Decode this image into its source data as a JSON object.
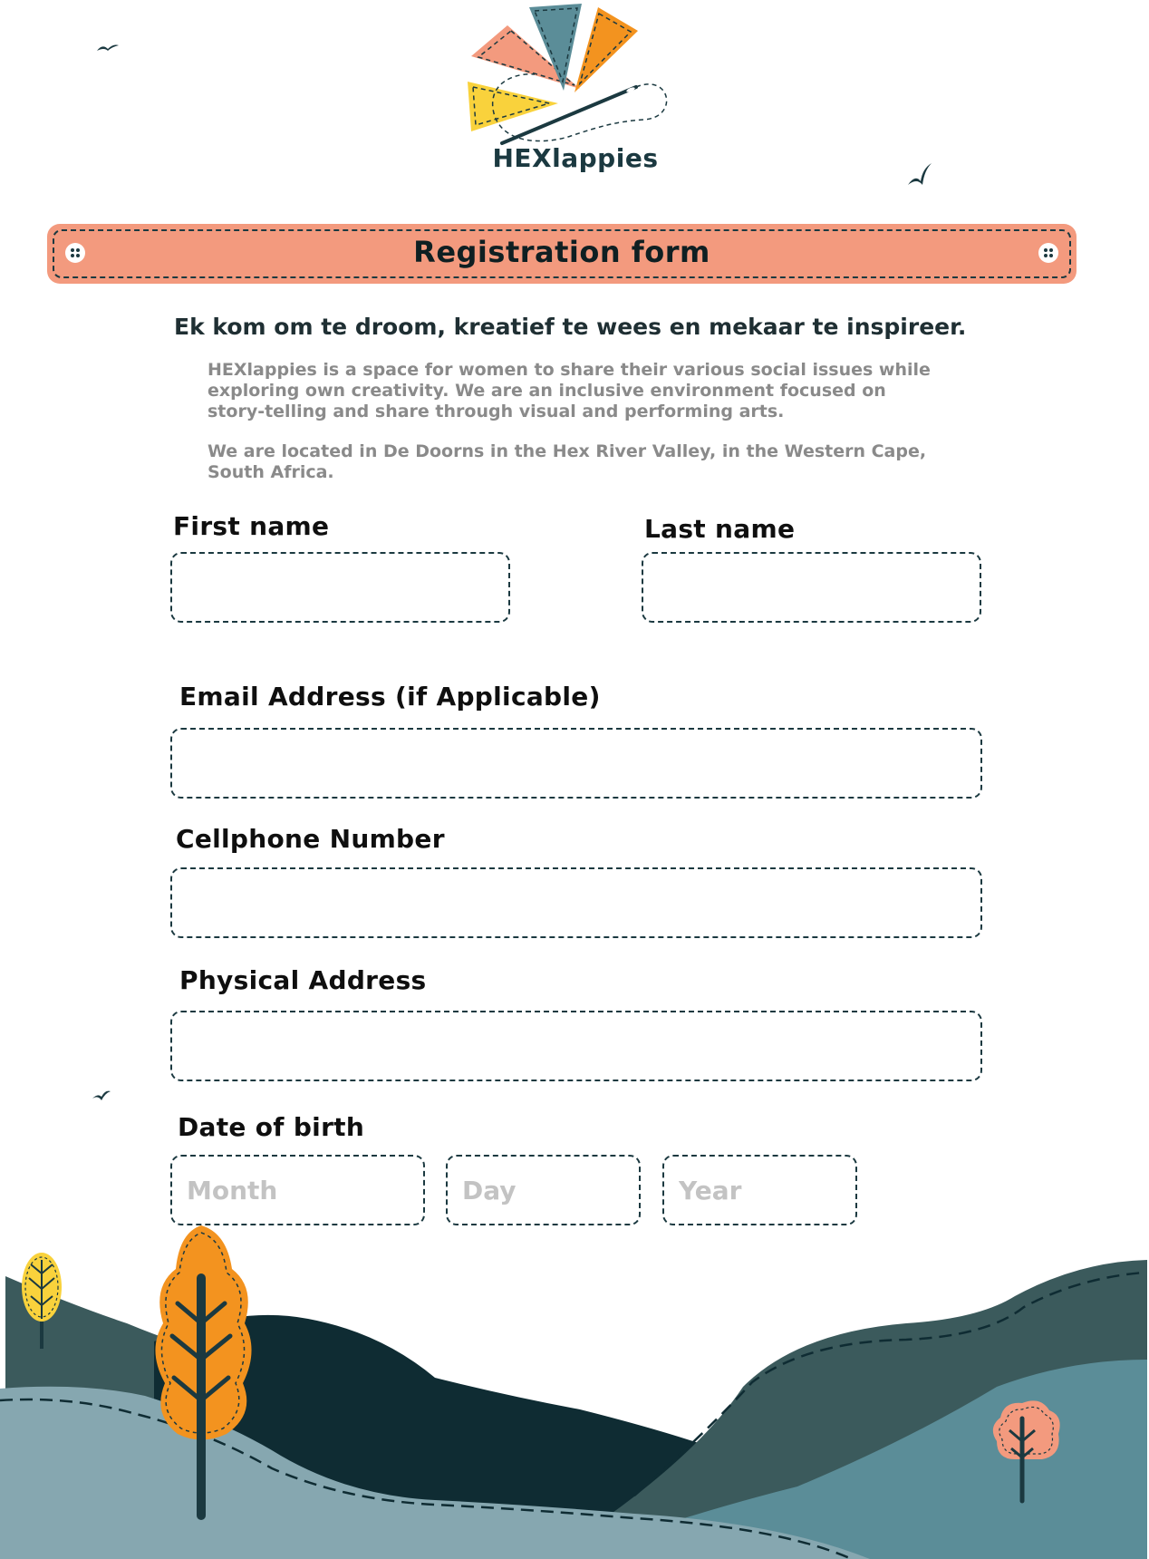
{
  "brand": {
    "name": "HEXlappies"
  },
  "banner": {
    "title": "Registration form"
  },
  "intro": {
    "tagline": "Ek kom om te droom, kreatief te wees en mekaar te inspireer.",
    "paragraph1": "HEXlappies is a space for women to share their various social issues while exploring own creativity. We are an inclusive environment focused on story-telling and share through visual and performing arts.",
    "paragraph2": "We are located in De Doorns in the Hex River Valley, in the Western Cape, South Africa."
  },
  "form": {
    "first_name_label": "First name",
    "last_name_label": "Last name",
    "email_label": "Email Address (if Applicable)",
    "cellphone_label": "Cellphone Number",
    "address_label": "Physical Address",
    "dob_label": "Date of birth",
    "month_placeholder": "Month",
    "day_placeholder": "Day",
    "year_placeholder": "Year"
  },
  "colors": {
    "banner": "#f39a7e",
    "dark_teal": "#0f2c33",
    "slate": "#3b5a5c",
    "steel_blue": "#5b8d98",
    "pale_blue": "#86a7b0",
    "orange": "#f3931f",
    "yellow": "#f9d23c",
    "salmon": "#f39a7e"
  }
}
